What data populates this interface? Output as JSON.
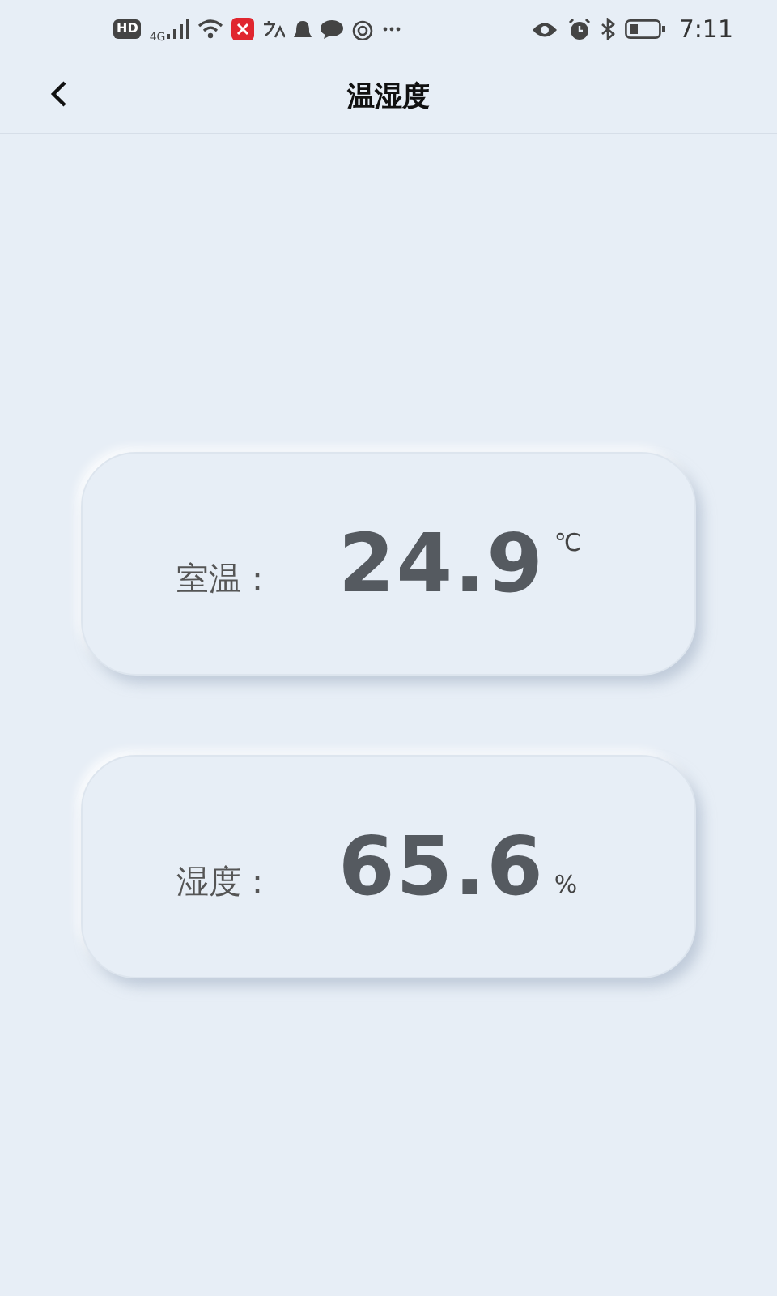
{
  "status_bar": {
    "badge": "HD",
    "network": "4G",
    "time": "7:11"
  },
  "header": {
    "title": "温湿度"
  },
  "readings": [
    {
      "kind": "temperature",
      "label": "室温：",
      "value": "24.9",
      "unit": "℃"
    },
    {
      "kind": "humidity",
      "label": "湿度：",
      "value": "65.6",
      "unit": "%"
    }
  ]
}
